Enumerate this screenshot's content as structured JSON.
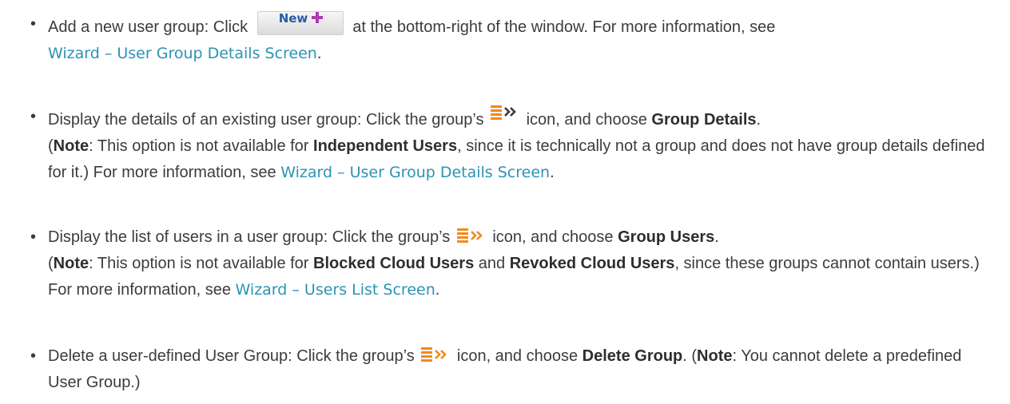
{
  "items": [
    {
      "prefix": "Add a new user group: Click",
      "button_label": "New",
      "suffix": "at the bottom-right of the window. For more information, see",
      "link": "Wizard – User Group Details Screen",
      "end": "."
    },
    {
      "prefix": "Display the details of an existing user group: Click the group’s",
      "mid": "icon, and choose",
      "bold1": "Group Details",
      "after_bold1": ".",
      "paren_open": "(",
      "note": "Note",
      "note_text": ": This option is not available for",
      "bold2": "Independent Users",
      "rest": ", since it is technically not a group and does not have group details defined for it.) For more information, see",
      "link": "Wizard – User Group Details Screen",
      "end": "."
    },
    {
      "prefix": "Display the list of users in a user group: Click the group’s",
      "mid": "icon, and choose",
      "bold1": "Group Users",
      "after_bold1": ".",
      "paren_open": "(",
      "note": "Note",
      "note_text": ": This option is not available for",
      "bold2": "Blocked Cloud Users",
      "and": "and",
      "bold3": "Revoked Cloud Users",
      "rest": ", since these groups cannot contain users.) For more information, see",
      "link": "Wizard – Users List Screen",
      "end": "."
    },
    {
      "prefix": "Delete a user-defined User Group: Click the group’s",
      "mid": "icon, and choose",
      "bold1": "Delete Group",
      "after_bold1": ".",
      "paren_open": "(",
      "note": "Note",
      "rest": ": You cannot delete a predefined User Group.)"
    }
  ],
  "bullet": "•",
  "icons": {
    "actions": "actions-menu-icon",
    "plus": "plus-icon"
  },
  "colors": {
    "text": "#3c3c3c",
    "link": "#2a93b5",
    "plus": "#b03ab0",
    "icon_orange": "#f08a1c",
    "new_label": "#2a5aa8"
  }
}
